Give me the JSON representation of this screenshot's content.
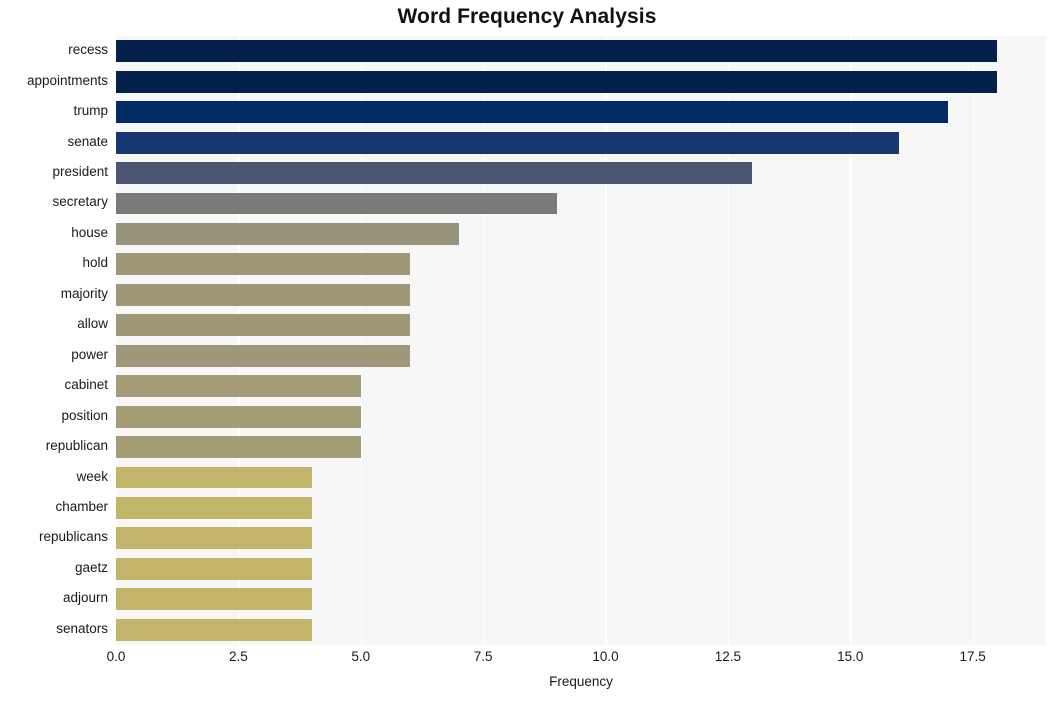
{
  "chart_data": {
    "type": "bar",
    "orientation": "horizontal",
    "title": "Word Frequency Analysis",
    "xlabel": "Frequency",
    "ylabel": "",
    "categories": [
      "recess",
      "appointments",
      "trump",
      "senate",
      "president",
      "secretary",
      "house",
      "hold",
      "majority",
      "allow",
      "power",
      "cabinet",
      "position",
      "republican",
      "week",
      "chamber",
      "republicans",
      "gaetz",
      "adjourn",
      "senators"
    ],
    "values": [
      18,
      18,
      17,
      16,
      13,
      9,
      7,
      6,
      6,
      6,
      6,
      5,
      5,
      5,
      4,
      4,
      4,
      4,
      4,
      4
    ],
    "bar_colors": [
      "#03214b",
      "#03214b",
      "#032b63",
      "#173770",
      "#4c5672",
      "#7a7a78",
      "#98937b",
      "#9e9878",
      "#9e9878",
      "#9e9878",
      "#9e9878",
      "#a39c77",
      "#a39c77",
      "#a39c77",
      "#c2b468",
      "#c2b468",
      "#c2b468",
      "#c2b468",
      "#c2b468",
      "#c2b468"
    ],
    "xlim": [
      0.0,
      19.0
    ],
    "xticks": [
      0.0,
      2.5,
      5.0,
      7.5,
      10.0,
      12.5,
      15.0,
      17.5
    ],
    "xtick_labels": [
      "0.0",
      "2.5",
      "5.0",
      "7.5",
      "10.0",
      "12.5",
      "15.0",
      "17.5"
    ],
    "grid": "vertical",
    "grid_color": "#ffffff",
    "plot_background": "#f7f7f7",
    "figure_background": "#ffffff",
    "legend": null
  }
}
